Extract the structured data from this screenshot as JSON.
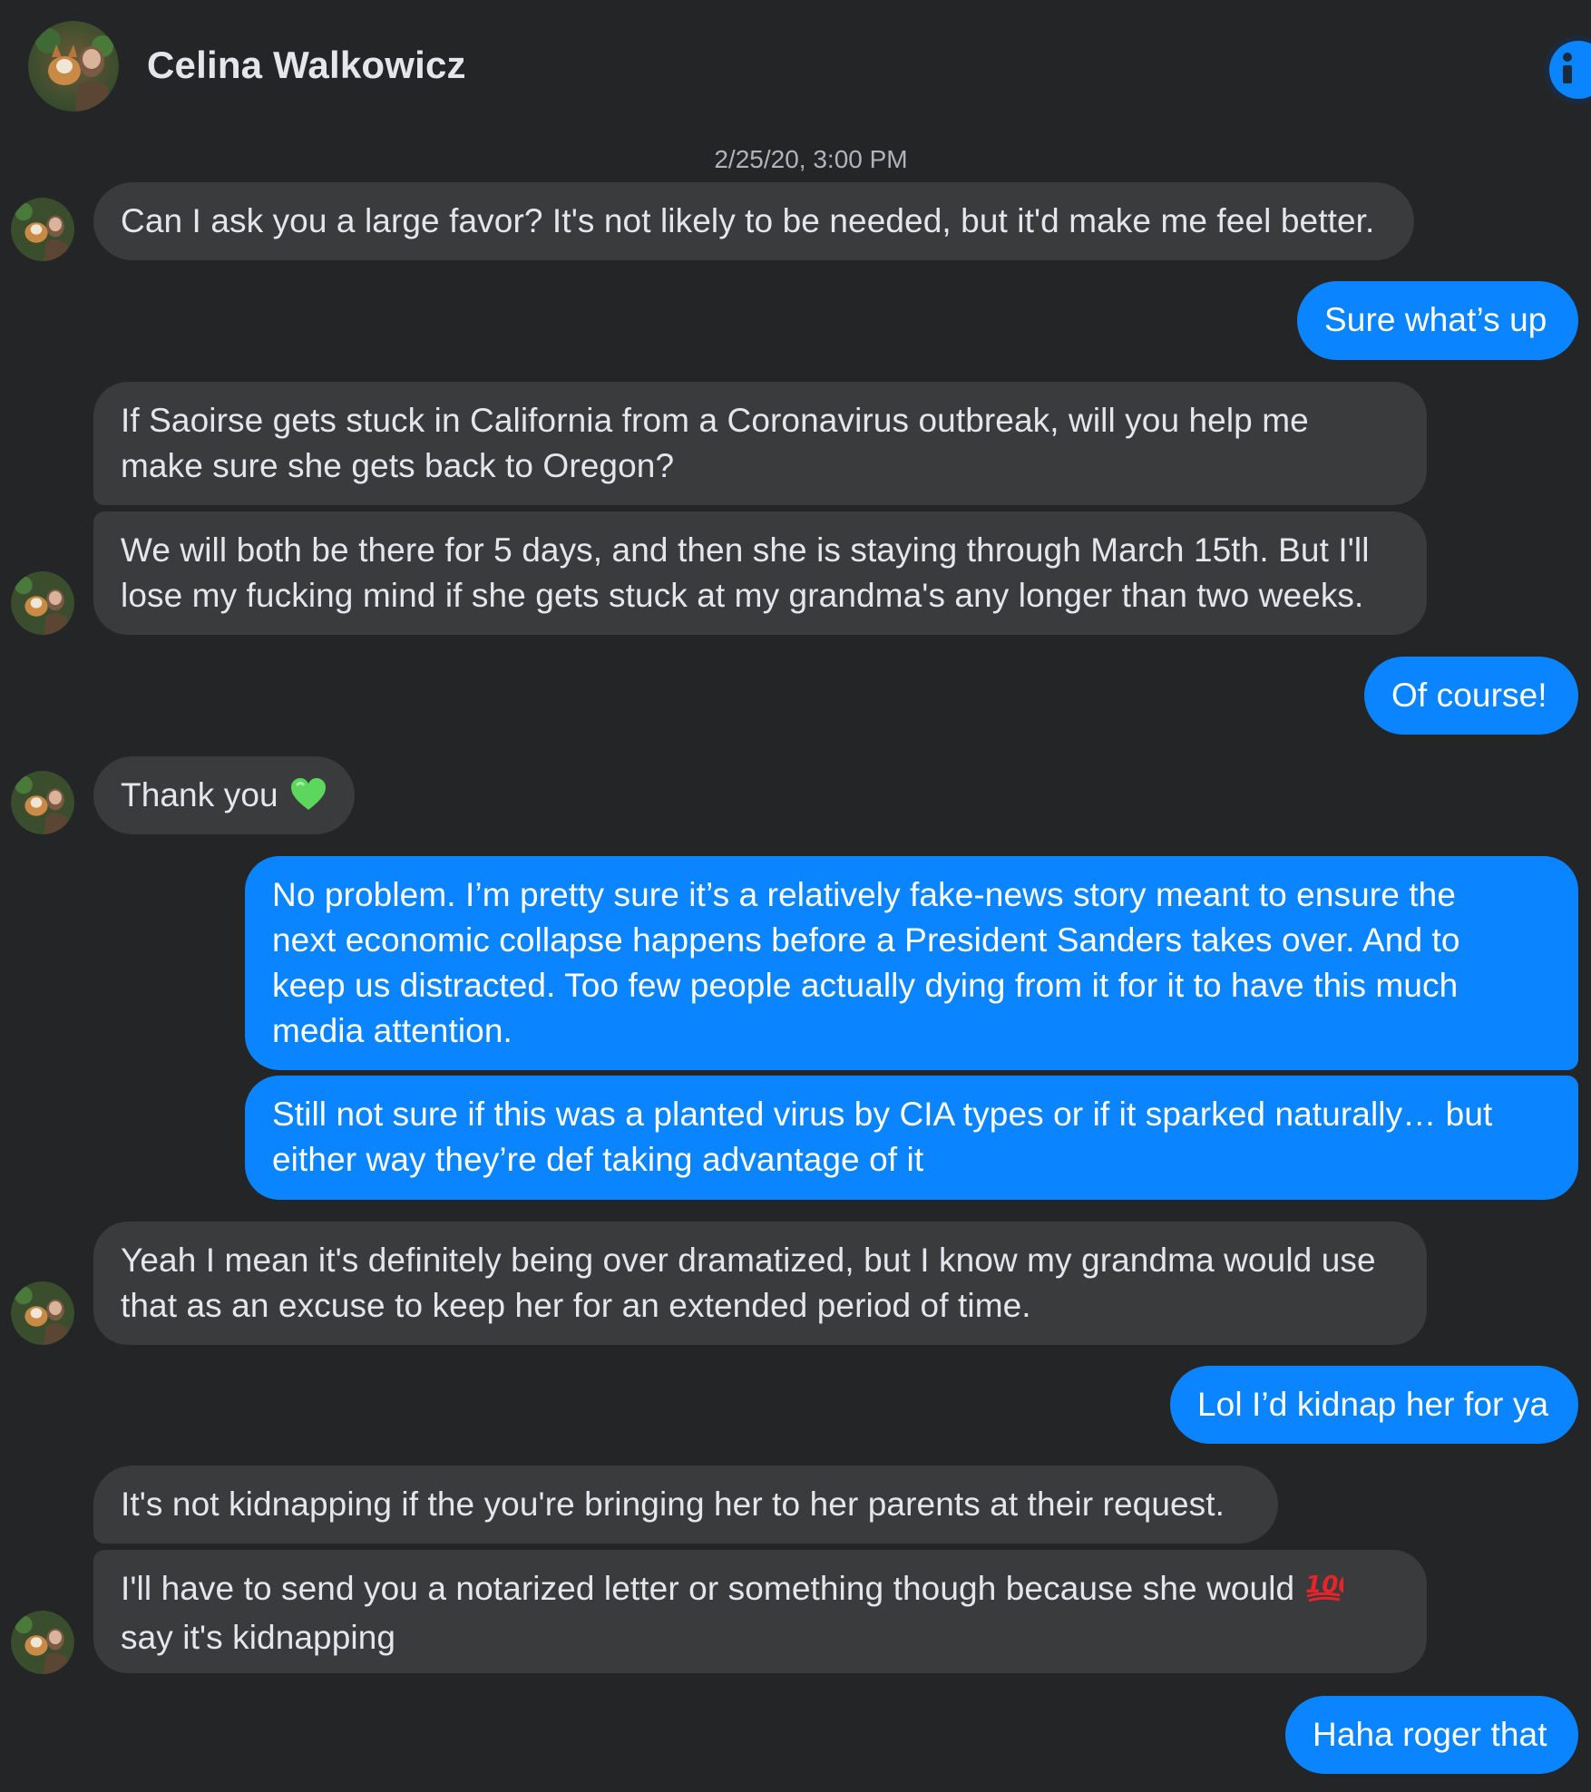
{
  "contact": {
    "name": "Celina Walkowicz"
  },
  "conversation": {
    "timestamp": "2/25/20, 3:00 PM"
  },
  "messages": [
    {
      "direction": "incoming",
      "lines": [
        "Can I ask you a large favor? It's not likely to be needed, but it'd make me feel better."
      ]
    },
    {
      "direction": "outgoing",
      "lines": [
        "Sure what’s up"
      ]
    },
    {
      "direction": "incoming",
      "lines": [
        "If Saoirse gets stuck in California from a Coronavirus outbreak, will you help me",
        "make sure she gets back to Oregon?"
      ]
    },
    {
      "direction": "incoming",
      "lines": [
        "We will both be there for 5 days, and then she is staying through March 15th. But I'll",
        "lose my fucking mind if she gets stuck at my grandma's any longer than two weeks."
      ]
    },
    {
      "direction": "outgoing",
      "lines": [
        "Of course!"
      ]
    },
    {
      "direction": "incoming",
      "lines": [
        "Thank you"
      ],
      "emoji": "green-heart"
    },
    {
      "direction": "outgoing",
      "lines": [
        "No problem. I’m pretty sure it’s a relatively fake-news story meant to ensure the",
        "next economic collapse happens before a President Sanders takes over. And to",
        "keep us distracted. Too few people actually dying from it for it to have this much",
        "media attention."
      ]
    },
    {
      "direction": "outgoing",
      "lines": [
        "Still not sure if this was a planted virus by CIA types or if it sparked naturally… but",
        "either way they’re def taking advantage of it"
      ]
    },
    {
      "direction": "incoming",
      "lines": [
        "Yeah I mean it's definitely being over dramatized, but I know my grandma would use",
        "that as an excuse to keep her for an extended period of time."
      ]
    },
    {
      "direction": "outgoing",
      "lines": [
        "Lol I’d kidnap her for ya"
      ]
    },
    {
      "direction": "incoming",
      "lines": [
        "It's not kidnapping if the you're bringing her to her parents at their request."
      ]
    },
    {
      "direction": "incoming",
      "lines": [
        "I'll have to send you a notarized letter or something though because she would",
        "say it's kidnapping"
      ],
      "emoji": "hundred-points"
    },
    {
      "direction": "outgoing",
      "lines": [
        "Haha roger that"
      ]
    }
  ],
  "colors": {
    "background": "#242526",
    "incoming_bubble": "#3a3b3c",
    "outgoing_bubble": "#0a84ff",
    "text_primary": "#e4e6eb",
    "text_secondary": "#b0b3b8",
    "heart": "#5cd65c",
    "hundred": "#e8232a"
  },
  "icons": {
    "info": "info-icon",
    "avatar": "contact-avatar"
  }
}
